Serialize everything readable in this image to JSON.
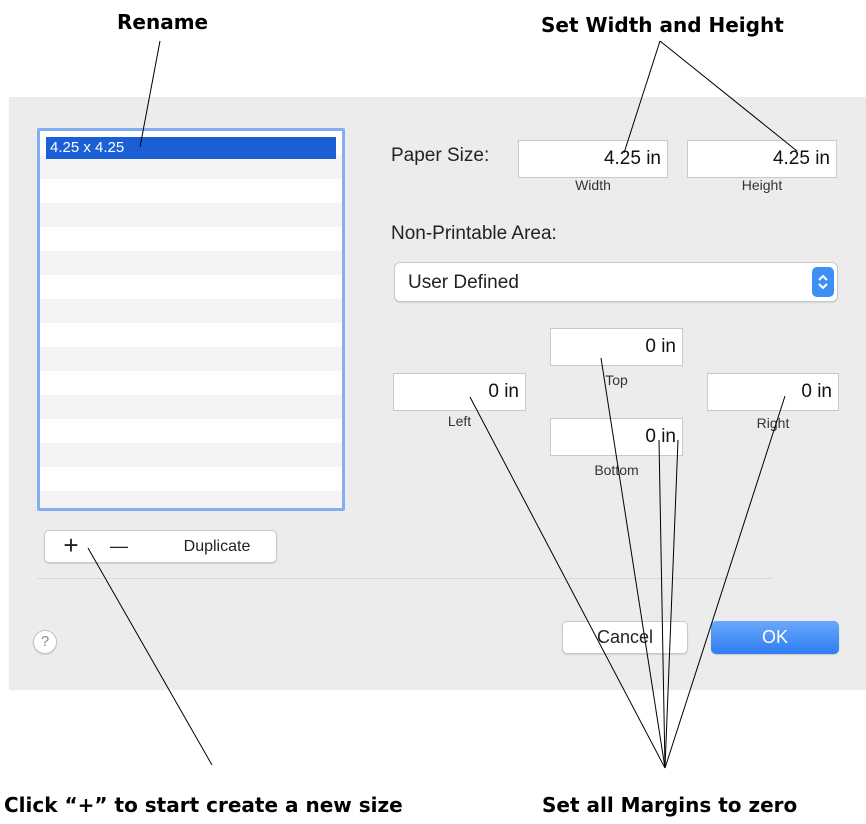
{
  "callouts": {
    "rename": "Rename",
    "set_width_height": "Set Width and Height",
    "click_plus": "Click “+” to start create a new size",
    "set_margins": "Set all Margins to zero"
  },
  "size_list": {
    "items": [
      "4.25 x 4.25"
    ]
  },
  "list_buttons": {
    "add": "+",
    "remove": "—",
    "duplicate": "Duplicate"
  },
  "paper_size": {
    "label": "Paper Size:",
    "width_value": "4.25 in",
    "width_label": "Width",
    "height_value": "4.25 in",
    "height_label": "Height"
  },
  "non_printable": {
    "label": "Non-Printable Area:",
    "selected": "User Defined"
  },
  "margins": {
    "top_value": "0 in",
    "top_label": "Top",
    "left_value": "0 in",
    "left_label": "Left",
    "right_value": "0 in",
    "right_label": "Right",
    "bottom_value": "0 in",
    "bottom_label": "Bottom"
  },
  "footer": {
    "help": "?",
    "cancel": "Cancel",
    "ok": "OK"
  },
  "colors": {
    "accent": "#1b5fd7",
    "ok_button": "#3d8ff5",
    "list_border": "#84aef0"
  }
}
